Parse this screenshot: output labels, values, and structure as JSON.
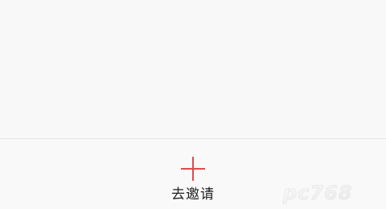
{
  "bottom_bar": {
    "invite_label": "去邀请",
    "icon": "plus-icon",
    "accent_color": "#e04a4a"
  },
  "watermark": {
    "text": "pc768"
  },
  "colors": {
    "background": "#f8f8f8",
    "divider": "#e6e6e6",
    "label_text": "#1f1f1f"
  }
}
